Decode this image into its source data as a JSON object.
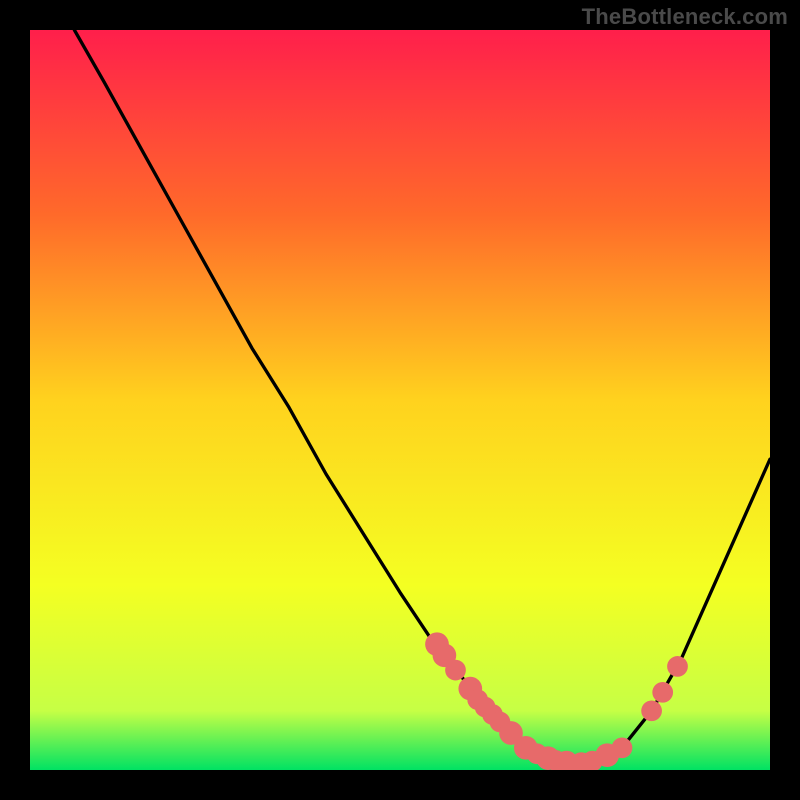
{
  "watermark": "TheBottleneck.com",
  "chart_data": {
    "type": "line",
    "title": "",
    "xlabel": "",
    "ylabel": "",
    "xlim": [
      0,
      100
    ],
    "ylim": [
      0,
      100
    ],
    "grid": false,
    "background_gradient_stops": [
      {
        "pct": 0,
        "color": "#ff1f4b"
      },
      {
        "pct": 25,
        "color": "#ff6a2a"
      },
      {
        "pct": 50,
        "color": "#ffd21e"
      },
      {
        "pct": 75,
        "color": "#f4ff22"
      },
      {
        "pct": 92,
        "color": "#c6ff45"
      },
      {
        "pct": 100,
        "color": "#00e263"
      }
    ],
    "series": [
      {
        "name": "bottleneck-curve",
        "x": [
          6,
          10,
          15,
          20,
          25,
          30,
          35,
          40,
          45,
          50,
          54,
          58,
          62,
          65,
          68,
          71,
          73,
          76,
          80,
          84,
          88,
          92,
          96,
          100
        ],
        "y": [
          100,
          93,
          84,
          75,
          66,
          57,
          49,
          40,
          32,
          24,
          18,
          13,
          8,
          5,
          3,
          1.5,
          1,
          1.2,
          3,
          8,
          15,
          24,
          33,
          42
        ]
      }
    ],
    "markers": [
      {
        "x": 55.0,
        "y": 17,
        "r": 1.6
      },
      {
        "x": 56.0,
        "y": 15.5,
        "r": 1.6
      },
      {
        "x": 57.5,
        "y": 13.5,
        "r": 1.4
      },
      {
        "x": 59.5,
        "y": 11.0,
        "r": 1.6
      },
      {
        "x": 60.5,
        "y": 9.5,
        "r": 1.4
      },
      {
        "x": 61.5,
        "y": 8.5,
        "r": 1.4
      },
      {
        "x": 62.5,
        "y": 7.5,
        "r": 1.4
      },
      {
        "x": 63.5,
        "y": 6.5,
        "r": 1.4
      },
      {
        "x": 65.0,
        "y": 5.0,
        "r": 1.6
      },
      {
        "x": 67.0,
        "y": 3.0,
        "r": 1.6
      },
      {
        "x": 68.5,
        "y": 2.2,
        "r": 1.4
      },
      {
        "x": 70.0,
        "y": 1.6,
        "r": 1.6
      },
      {
        "x": 71.0,
        "y": 1.3,
        "r": 1.4
      },
      {
        "x": 72.5,
        "y": 1.0,
        "r": 1.6
      },
      {
        "x": 74.5,
        "y": 1.0,
        "r": 1.4
      },
      {
        "x": 76.0,
        "y": 1.2,
        "r": 1.4
      },
      {
        "x": 78.0,
        "y": 2.0,
        "r": 1.6
      },
      {
        "x": 80.0,
        "y": 3.0,
        "r": 1.4
      },
      {
        "x": 84.0,
        "y": 8.0,
        "r": 1.4
      },
      {
        "x": 85.5,
        "y": 10.5,
        "r": 1.4
      },
      {
        "x": 87.5,
        "y": 14.0,
        "r": 1.4
      }
    ],
    "marker_color": "#e76a6a",
    "curve_color": "#000000"
  }
}
